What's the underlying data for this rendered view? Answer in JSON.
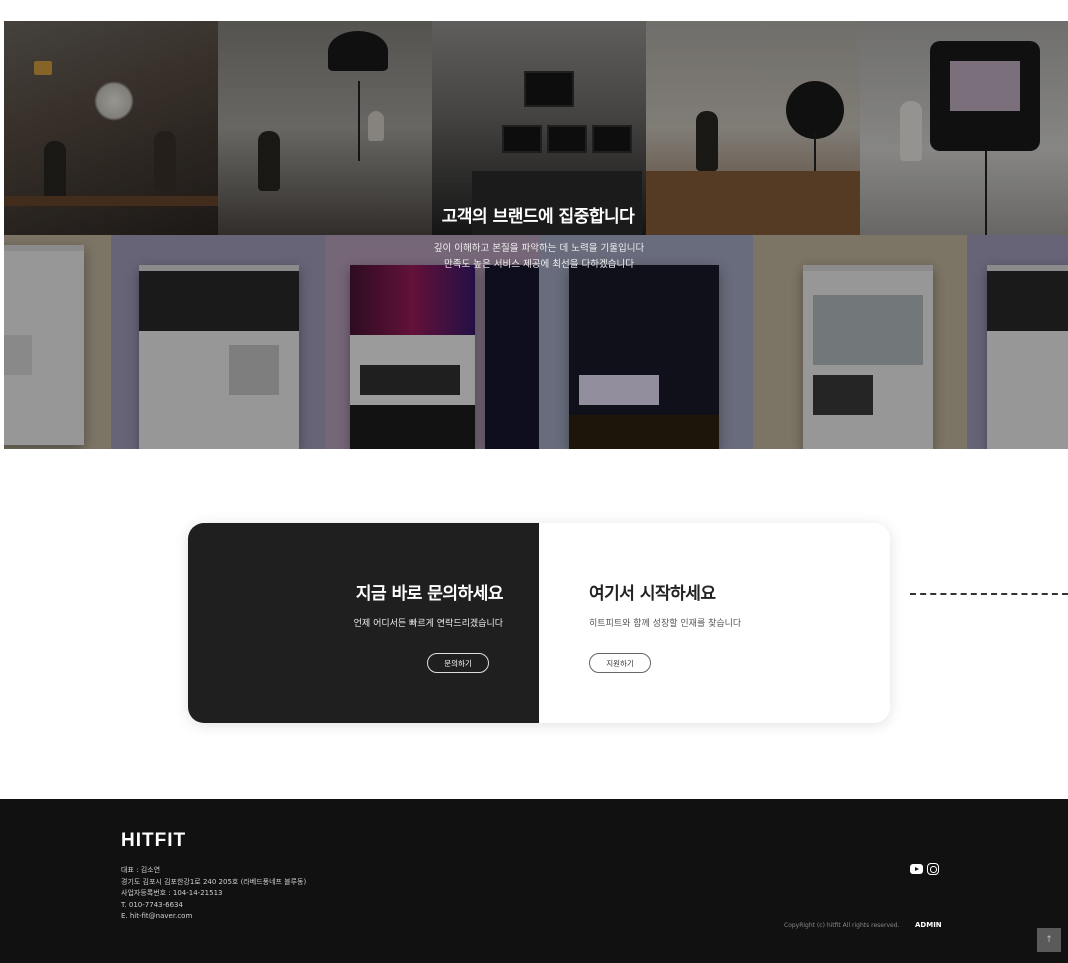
{
  "hero": {
    "title": "고객의 브랜드에 집중합니다",
    "subtitle_line1": "깊이 이해하고 본질을 파악하는 데 노력을 기울입니다",
    "subtitle_line2": "만족도 높은 서비스 제공에 최선을 다하겠습니다"
  },
  "cta": {
    "contact": {
      "title": "지금 바로 문의하세요",
      "description": "언제 어디서든 빠르게 연락드리겠습니다",
      "button_label": "문의하기"
    },
    "recruit": {
      "title": "여기서 시작하세요",
      "description": "히트피트와 함께 성장할 인재를 찾습니다",
      "button_label": "지원하기"
    }
  },
  "footer": {
    "logo": "HITFIT",
    "info_lines": [
      "대표 : 김소연",
      "경기도 김포시 김포한강1로 240 205호 (라베드퐁네프 블루동)",
      "사업자등록번호 : 104-14-21513",
      "T. 010-7743-6634",
      "E. hit-fit@naver.com"
    ],
    "social_icons": [
      "youtube-icon",
      "instagram-icon"
    ],
    "copyright": "CopyRight (c) hitfit All rights reserved.",
    "admin_label": "ADMIN"
  },
  "scroll_top_icon": "↑",
  "colors": {
    "dark_panel": "#1f1f1f",
    "footer_bg": "#111111",
    "page_bg": "#ffffff"
  }
}
